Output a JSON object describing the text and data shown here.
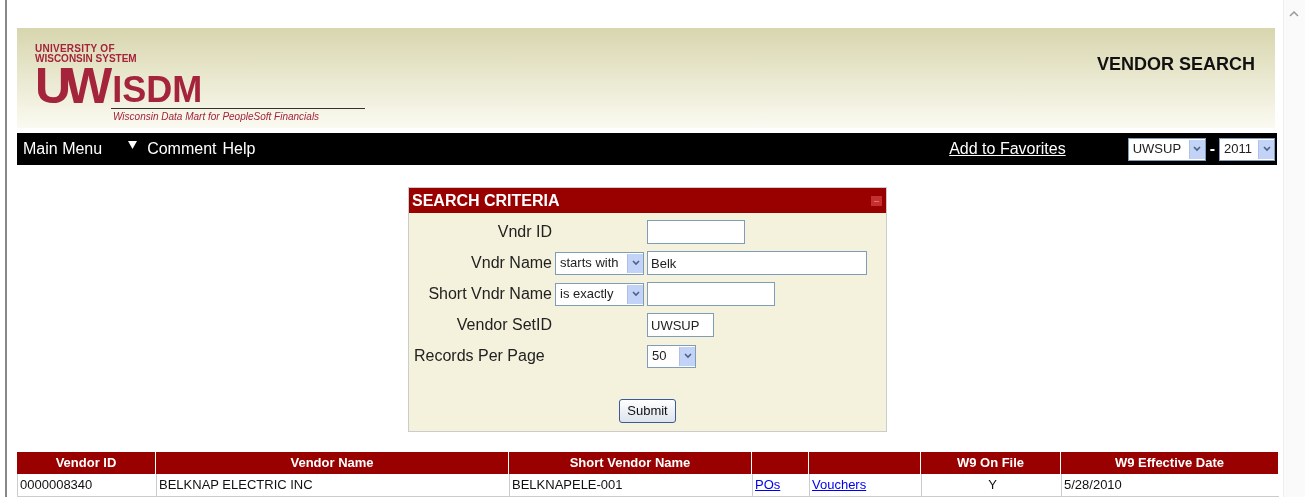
{
  "logo": {
    "line_1": "UNIVERSITY OF",
    "line_2": "WISCONSIN SYSTEM",
    "mark": "UW",
    "name": "ISDM",
    "tagline": "Wisconsin Data Mart for PeopleSoft Financials"
  },
  "page_title": "VENDOR SEARCH",
  "nav": {
    "items": [
      "Main Menu",
      "Comment",
      "Help"
    ],
    "favorites_link": "Add to Favorites",
    "setid": "UWSUP",
    "separator": "-",
    "year": "2011"
  },
  "search_criteria": {
    "title": "SEARCH CRITERIA",
    "collapse_icon": "–",
    "fields": [
      {
        "kind": "text",
        "label": "Vndr ID"
      },
      {
        "kind": "op_text",
        "label": "Vndr Name",
        "operator": "starts with",
        "value": "Belk"
      },
      {
        "kind": "op_text",
        "label": "Short Vndr Name",
        "operator": "is exactly"
      },
      {
        "kind": "text",
        "label": "Vendor SetID",
        "value": "UWSUP"
      },
      {
        "kind": "select",
        "label": "Records Per Page",
        "value": "50"
      }
    ],
    "submit": "Submit"
  },
  "table": {
    "columns": [
      "Vendor ID",
      "Vendor Name",
      "Short Vendor Name",
      null,
      null,
      "W9 On File",
      "W9 Effective Date"
    ],
    "rows": [
      {
        "vendor_id": "0000008340",
        "vendor_name": "BELKNAP ELECTRIC INC",
        "short_vendor_name": "BELKNAPELE-001",
        "pos_link": "POs",
        "vouchers_link": "Vouchers",
        "w9_on_file": "Y",
        "w9_effective_date": "5/28/2010"
      }
    ]
  }
}
